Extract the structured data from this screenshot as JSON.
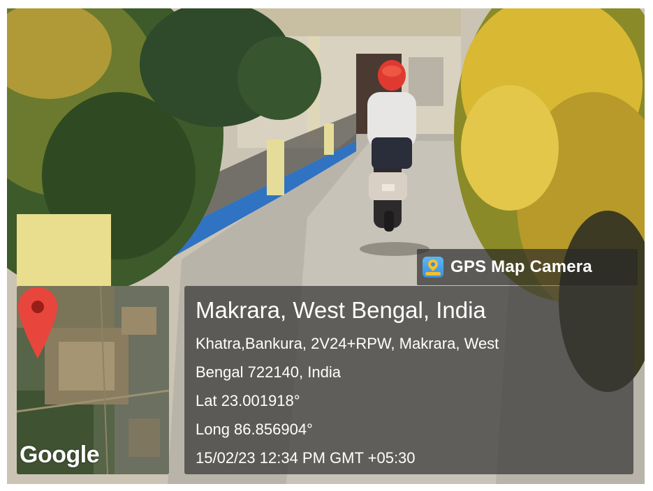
{
  "app": {
    "name": "GPS Map Camera",
    "icon": "gps-map-camera-app-icon"
  },
  "map": {
    "provider_logo": "Google",
    "marker_icon": "location-pin-icon",
    "marker_color": "#e8463c"
  },
  "location": {
    "title": "Makrara, West Bengal, India",
    "address_line1": "Khatra,Bankura, 2V24+RPW, Makrara, West",
    "address_line2": "Bengal 722140, India",
    "latitude": "Lat 23.001918°",
    "longitude": "Long 86.856904°",
    "timestamp": "15/02/23 12:34 PM GMT +05:30"
  },
  "colors": {
    "panel_bg": "#373737",
    "text": "#ffffff",
    "app_icon": "#3a8fe0",
    "pin_yellow": "#f6c02a"
  }
}
